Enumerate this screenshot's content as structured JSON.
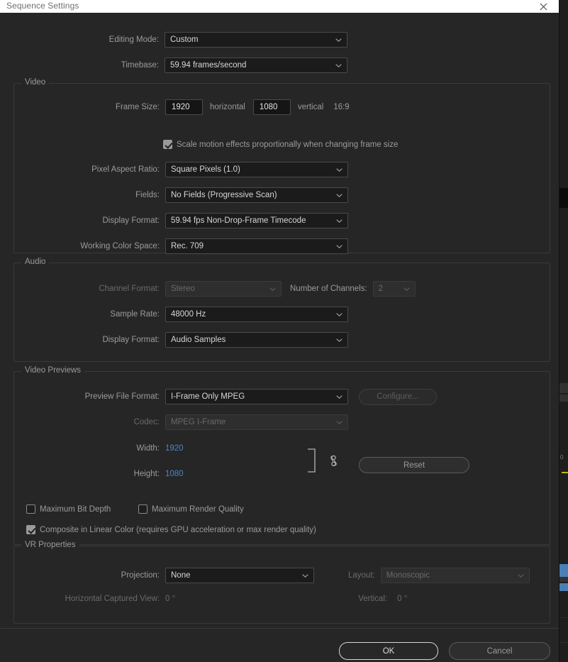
{
  "window": {
    "title": "Sequence Settings",
    "close_icon": "close-icon"
  },
  "top": {
    "editing_mode": {
      "label": "Editing Mode:",
      "value": "Custom"
    },
    "timebase": {
      "label": "Timebase:",
      "value": "59.94  frames/second"
    }
  },
  "video": {
    "group_title": "Video",
    "frame_size": {
      "label": "Frame Size:",
      "horizontal_value": "1920",
      "horizontal_label": "horizontal",
      "vertical_value": "1080",
      "vertical_label": "vertical",
      "aspect": "16:9"
    },
    "scale_motion": {
      "label": "Scale motion effects proportionally when changing frame size",
      "checked": true
    },
    "pixel_aspect_ratio": {
      "label": "Pixel Aspect Ratio:",
      "value": "Square Pixels (1.0)"
    },
    "fields": {
      "label": "Fields:",
      "value": "No Fields (Progressive Scan)"
    },
    "display_format": {
      "label": "Display Format:",
      "value": "59.94 fps Non-Drop-Frame Timecode"
    },
    "working_color_space": {
      "label": "Working Color Space:",
      "value": "Rec. 709"
    }
  },
  "audio": {
    "group_title": "Audio",
    "channel_format": {
      "label": "Channel Format:",
      "value": "Stereo",
      "disabled": true
    },
    "number_of_channels": {
      "label": "Number of Channels:",
      "value": "2",
      "disabled": true
    },
    "sample_rate": {
      "label": "Sample Rate:",
      "value": "48000 Hz"
    },
    "display_format": {
      "label": "Display Format:",
      "value": "Audio Samples"
    }
  },
  "video_previews": {
    "group_title": "Video Previews",
    "preview_file_format": {
      "label": "Preview File Format:",
      "value": "I-Frame Only MPEG"
    },
    "configure_button": {
      "label": "Configure...",
      "disabled": true
    },
    "codec": {
      "label": "Codec:",
      "value": "MPEG I-Frame",
      "disabled": true
    },
    "width": {
      "label": "Width:",
      "value": "1920"
    },
    "height": {
      "label": "Height:",
      "value": "1080"
    },
    "reset_button": {
      "label": "Reset"
    },
    "link_icon": "chain-link-icon",
    "bracket_icon": "link-bracket-icon",
    "maximum_bit_depth": {
      "label": "Maximum Bit Depth",
      "checked": false
    },
    "maximum_render_quality": {
      "label": "Maximum Render Quality",
      "checked": false
    },
    "composite_linear_color": {
      "label": "Composite in Linear Color (requires GPU acceleration or max render quality)",
      "checked": true
    }
  },
  "vr_properties": {
    "group_title": "VR Properties",
    "projection": {
      "label": "Projection:",
      "value": "None"
    },
    "layout": {
      "label": "Layout:",
      "value": "Monoscopic",
      "disabled": true
    },
    "horizontal_captured_view": {
      "label": "Horizontal Captured View:",
      "value": "0 °",
      "disabled": true
    },
    "vertical": {
      "label": "Vertical:",
      "value": "0 °",
      "disabled": true
    }
  },
  "footer": {
    "ok_label": "OK",
    "cancel_label": "Cancel"
  },
  "colors": {
    "dialog_bg": "#262626",
    "titlebar_bg": "#ffffff",
    "field_bg": "#1b1b1b",
    "accent_link": "#4a86c8",
    "border": "#3a3a3a"
  }
}
